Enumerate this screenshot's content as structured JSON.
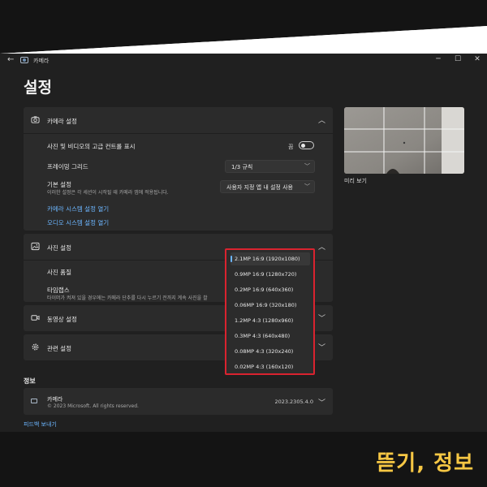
{
  "window": {
    "app_title": "카메라",
    "page_title": "설정"
  },
  "camera_settings": {
    "header": "카메라 설정",
    "advanced_controls_label": "사진 및 비디오의 고급 컨트롤 표시",
    "advanced_controls_state": "끔",
    "framing_grid_label": "프레이밍 그리드",
    "framing_grid_value": "1/3 규칙",
    "default_settings_label": "기본 설정",
    "default_settings_desc": "이러한 설정은 각 세션이 시작될 때 카메라 앱에 적용됩니다.",
    "default_settings_value": "사용자 지정 앱 내 설정 사용",
    "camera_system_link": "카메라 시스템 설정 열기",
    "audio_system_link": "오디오 시스템 설정 열기"
  },
  "photo_settings": {
    "header": "사진 설정",
    "quality_label": "사진 품질",
    "timelapse_label": "타임랩스",
    "timelapse_desc": "타이머가 켜져 있을 경우에는 카메라 단추를 다시 누르기 전까지 계속 사진을 촬"
  },
  "video_settings": {
    "header": "동영상 설정"
  },
  "related_settings": {
    "header": "관련 설정"
  },
  "quality_dropdown": {
    "selected_index": 0,
    "options": [
      "2.1MP 16:9 (1920x1080)",
      "0.9MP 16:9 (1280x720)",
      "0.2MP 16:9 (640x360)",
      "0.06MP 16:9 (320x180)",
      "1.2MP 4:3 (1280x960)",
      "0.3MP 4:3 (640x480)",
      "0.08MP 4:3 (320x240)",
      "0.02MP 4:3 (160x120)"
    ]
  },
  "preview": {
    "label": "미리 보기"
  },
  "info": {
    "section_title": "정보",
    "app_name": "카메라",
    "copyright": "© 2023 Microsoft. All rights reserved.",
    "version": "2023.2305.4.0",
    "feedback_link": "피드백 보내기"
  },
  "brand": {
    "label": "뜯기, 정보",
    "accent_color": "#f6c744"
  },
  "colors": {
    "window_bg": "#202020",
    "card_bg": "#2b2b2b",
    "link": "#6cb6ff",
    "highlight_border": "#d9232f"
  }
}
